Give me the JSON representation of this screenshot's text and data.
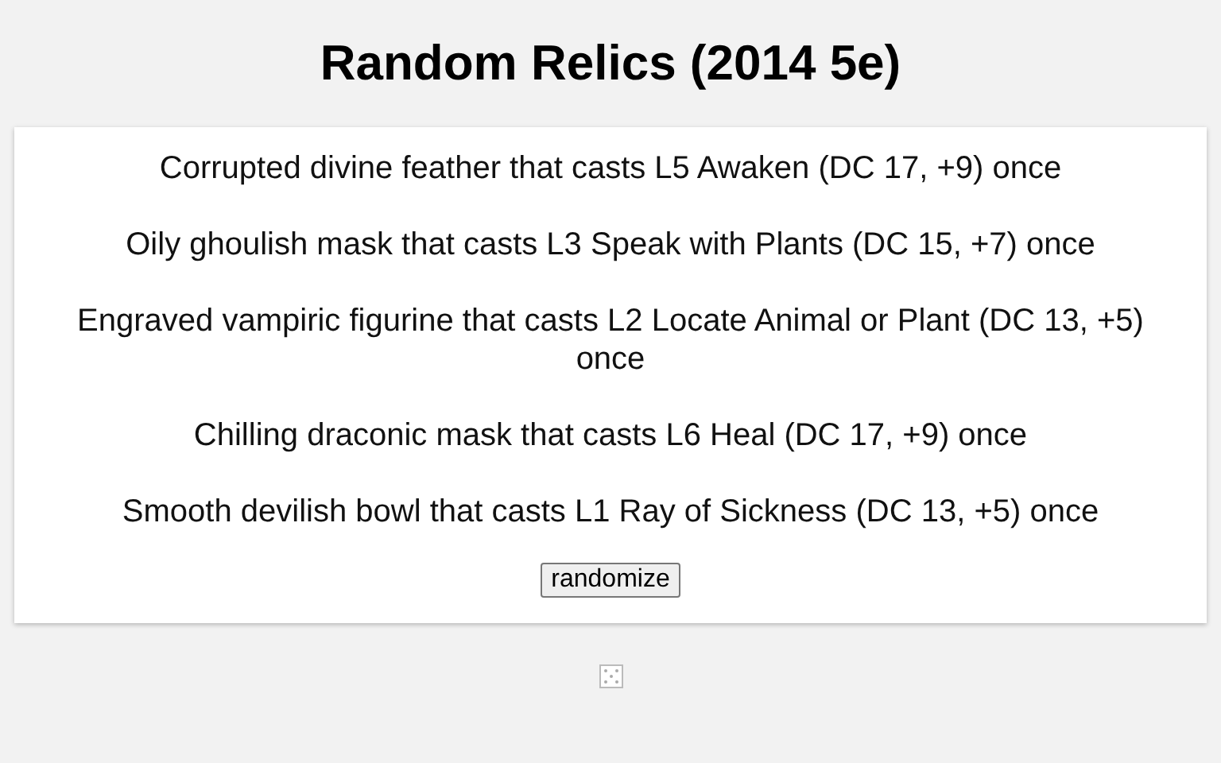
{
  "title": "Random Relics (2014 5e)",
  "relics": [
    "Corrupted divine feather that casts L5 Awaken (DC 17, +9) once",
    "Oily ghoulish mask that casts L3 Speak with Plants (DC 15, +7) once",
    "Engraved vampiric figurine that casts L2 Locate Animal or Plant (DC 13, +5) once",
    "Chilling draconic mask that casts L6 Heal (DC 17, +9) once",
    "Smooth devilish bowl that casts L1 Ray of Sickness (DC 13, +5) once"
  ],
  "button": "randomize"
}
